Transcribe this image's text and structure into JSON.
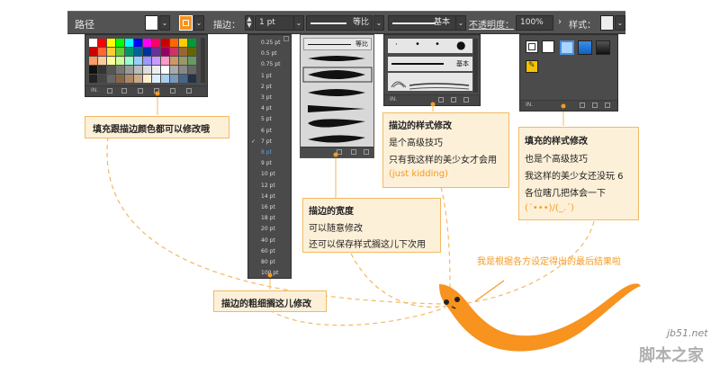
{
  "toolbar": {
    "title": "路径",
    "stroke_label": "描边：",
    "stroke_value": "1 pt",
    "profile_label": "等比",
    "brush_label": "基本",
    "opacity_label": "不透明度：",
    "opacity_value": "100%",
    "style_label": "样式："
  },
  "stroke_weights": [
    "0.25 pt",
    "0.5 pt",
    "0.75 pt",
    "1 pt",
    "2 pt",
    "3 pt",
    "4 pt",
    "5 pt",
    "6 pt",
    "7 pt",
    "8 pt",
    "9 pt",
    "10 pt",
    "12 pt",
    "14 pt",
    "16 pt",
    "18 pt",
    "20 pt",
    "40 pt",
    "60 pt",
    "80 pt",
    "100 pt"
  ],
  "profile_panel": {
    "first_label": "等比"
  },
  "brush_panel": {
    "label": "基本"
  },
  "callouts": {
    "fill": "填充跟描边颜色都可以修改哦",
    "brush": {
      "title": "描边的样式修改",
      "line1": "是个高级技巧",
      "line2": "只有我这样的美少女才会用",
      "line3": "(just kidding)"
    },
    "width": {
      "title": "描边的宽度",
      "line1": "可以随意修改",
      "line2": "还可以保存样式搁这儿下次用"
    },
    "style": {
      "title": "填充的样式修改",
      "line1": "也是个高级技巧",
      "line2": "我这样的美少女还没玩 6",
      "line3": "各位瞎几把体会一下",
      "line4": "(´•••)/(_.´)"
    },
    "weight": "描边的粗细搁这儿修改",
    "result": "我是根据各方设定得出的最后结果啦"
  },
  "watermark": {
    "site": "jb51.net",
    "name": "脚本之家"
  },
  "colors": {
    "accent": "#f59a23",
    "callout_bg": "#fdf0d8",
    "panel": "#4b4b4b",
    "bar": "#535353"
  }
}
